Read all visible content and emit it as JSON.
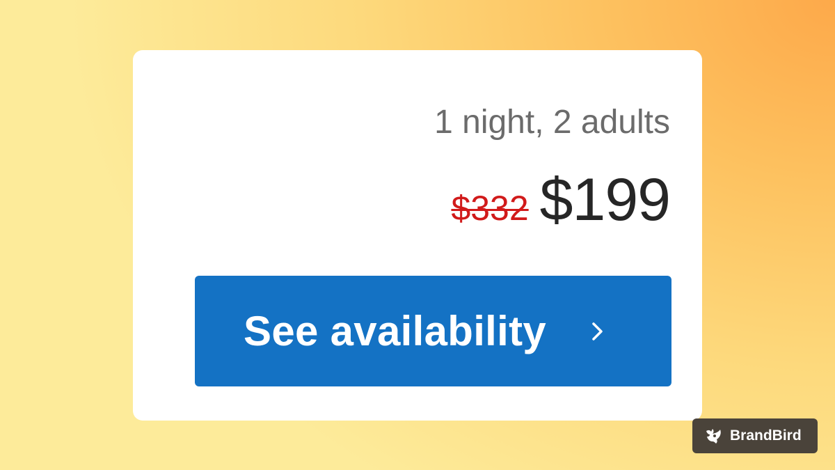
{
  "card": {
    "occupancy": "1 night, 2 adults",
    "original_price": "$332",
    "current_price": "$199",
    "cta_label": "See availability"
  },
  "badge": {
    "brand_name": "BrandBird"
  },
  "icons": {
    "cta": "chevron-right-icon",
    "brand": "brandbird-logo-icon"
  },
  "colors": {
    "accent": "#1472c4",
    "strikethrough_price": "#d11a1a",
    "price": "#262626",
    "secondary_text": "#6b6b6b",
    "badge_background": "#4a433a"
  }
}
